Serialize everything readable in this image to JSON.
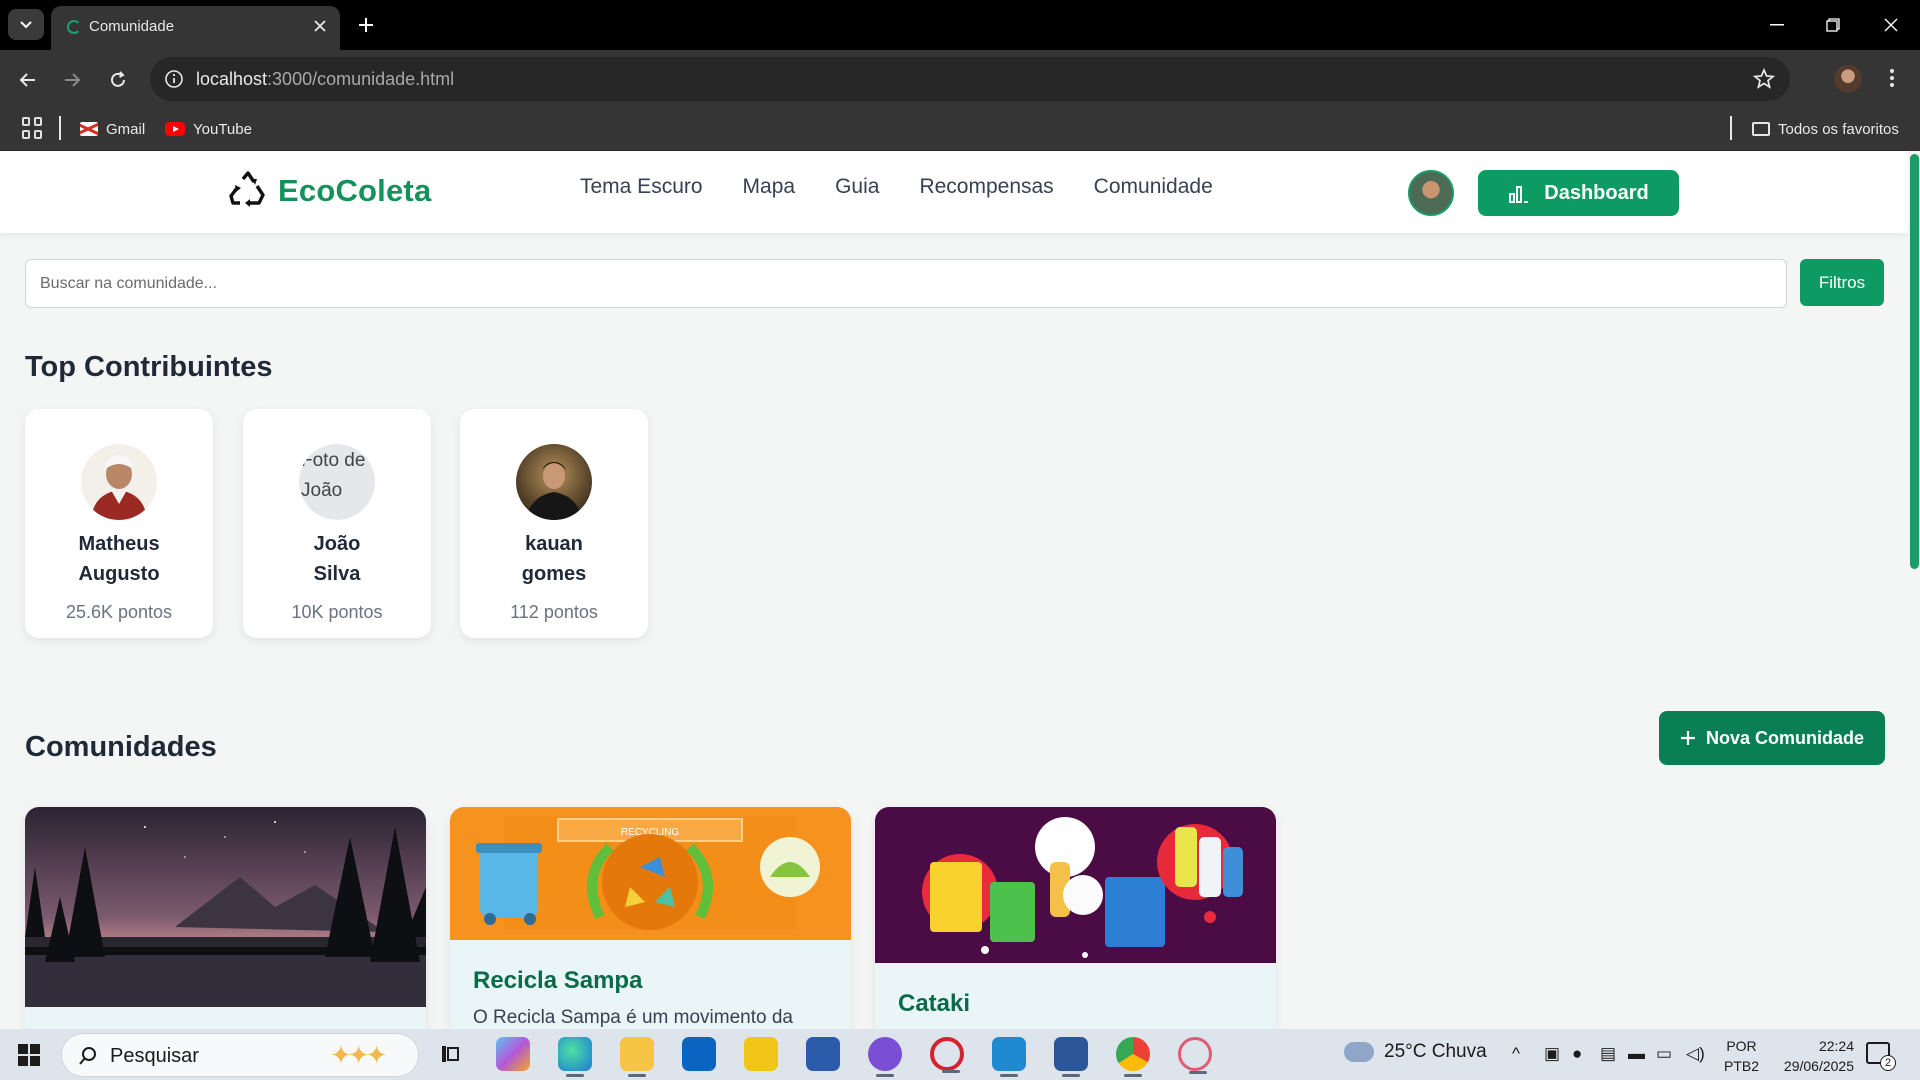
{
  "browser": {
    "tab_title": "Comunidade",
    "url_host": "localhost",
    "url_rest": ":3000/comunidade.html",
    "bookmarks": [
      {
        "label": "Gmail",
        "icon": "gmail-icon"
      },
      {
        "label": "YouTube",
        "icon": "youtube-icon"
      }
    ],
    "all_bookmarks_label": "Todos os favoritos"
  },
  "site": {
    "brand": "EcoColeta",
    "brand_color": "#16915b",
    "nav": [
      "Tema Escuro",
      "Mapa",
      "Guia",
      "Recompensas",
      "Comunidade"
    ],
    "dashboard_label": "Dashboard"
  },
  "search": {
    "placeholder": "Buscar na comunidade...",
    "value": "",
    "filters_label": "Filtros"
  },
  "top_contributors": {
    "title": "Top Contribuintes",
    "items": [
      {
        "name_line1": "Matheus",
        "name_line2": "Augusto",
        "points": "25.6K pontos"
      },
      {
        "name_line1": "João",
        "name_line2": "Silva",
        "points": "10K pontos",
        "broken_alt": "Foto de João"
      },
      {
        "name_line1": "kauan",
        "name_line2": "gomes",
        "points": "112 pontos"
      }
    ]
  },
  "communities": {
    "title": "Comunidades",
    "new_label": "Nova Comunidade",
    "cards": [
      {
        "title": "",
        "desc": ""
      },
      {
        "title": "Recicla Sampa",
        "desc": "O Recicla Sampa é um movimento da",
        "banner_text": "RECYCLING"
      },
      {
        "title": "Cataki",
        "desc": ""
      }
    ]
  },
  "taskbar": {
    "search_label": "Pesquisar",
    "weather": "25°C  Chuva",
    "lang_line1": "POR",
    "lang_line2": "PTB2",
    "time": "22:24",
    "date": "29/06/2025",
    "notif_count": "2"
  }
}
